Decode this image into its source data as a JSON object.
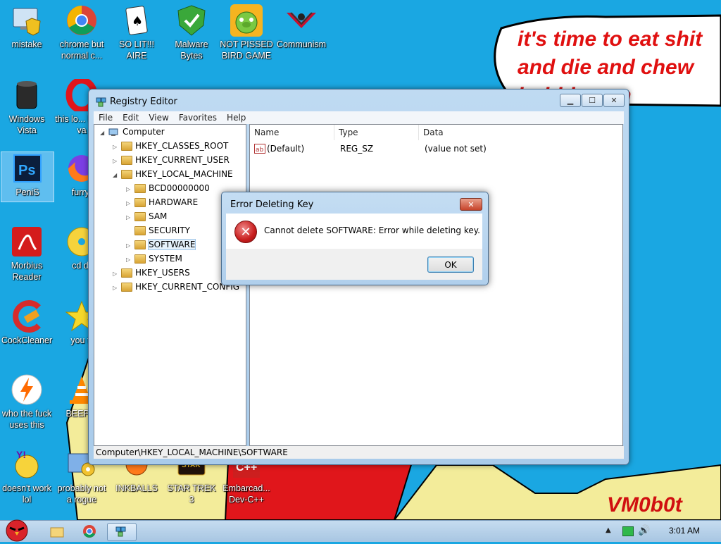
{
  "wallpaper": {
    "lines": [
      "it's time to eat shit",
      "and die and chew",
      "bubblegum"
    ],
    "signature": "VM0b0t"
  },
  "desktop_icons": [
    {
      "label": "mistake",
      "icon": "computer-shield-icon"
    },
    {
      "label": "chrome but normal c...",
      "icon": "chrome-icon"
    },
    {
      "label": "SO LIT!!! AIRE",
      "icon": "cards-icon"
    },
    {
      "label": "Malware Bytes",
      "icon": "shield-check-icon"
    },
    {
      "label": "NOT PISSED BIRD GAME",
      "icon": "green-pig-icon"
    },
    {
      "label": "Communism",
      "icon": "hammer-sickle-icon"
    },
    {
      "label": "Windows Vista",
      "icon": "trash-bin-icon"
    },
    {
      "label": "this lo... like a va",
      "icon": "opera-icon"
    },
    {
      "label": "PeniS",
      "icon": "photoshop-icon"
    },
    {
      "label": "furryf",
      "icon": "firefox-icon"
    },
    {
      "label": "Morbius Reader",
      "icon": "pdf-reader-icon"
    },
    {
      "label": "cd dr",
      "icon": "cd-icon"
    },
    {
      "label": "CockCleaner",
      "icon": "ccleaner-icon"
    },
    {
      "label": "you tr",
      "icon": "star-icon"
    },
    {
      "label": "who the fuck uses this",
      "icon": "lightning-icon"
    },
    {
      "label": "BEEP B",
      "icon": "vlc-cone-icon"
    },
    {
      "label": "doesn't work lol",
      "icon": "yahoo-icon"
    },
    {
      "label": "probably not a rogue",
      "icon": "gears-icon"
    },
    {
      "label": "INKBALLS",
      "icon": "inkball-icon"
    },
    {
      "label": "STAR TREK 3",
      "icon": "star-wars-icon"
    },
    {
      "label": "Embarcad... Dev-C++",
      "icon": "devcpp-icon"
    }
  ],
  "regedit": {
    "title": "Registry Editor",
    "menu": [
      "File",
      "Edit",
      "View",
      "Favorites",
      "Help"
    ],
    "tree": [
      {
        "label": "Computer",
        "depth": 0,
        "expander": "open"
      },
      {
        "label": "HKEY_CLASSES_ROOT",
        "depth": 1,
        "expander": "closed"
      },
      {
        "label": "HKEY_CURRENT_USER",
        "depth": 1,
        "expander": "closed"
      },
      {
        "label": "HKEY_LOCAL_MACHINE",
        "depth": 1,
        "expander": "open"
      },
      {
        "label": "BCD00000000",
        "depth": 2,
        "expander": "closed"
      },
      {
        "label": "HARDWARE",
        "depth": 2,
        "expander": "closed"
      },
      {
        "label": "SAM",
        "depth": 2,
        "expander": "closed"
      },
      {
        "label": "SECURITY",
        "depth": 2,
        "expander": "none"
      },
      {
        "label": "SOFTWARE",
        "depth": 2,
        "expander": "closed",
        "selected": true
      },
      {
        "label": "SYSTEM",
        "depth": 2,
        "expander": "closed"
      },
      {
        "label": "HKEY_USERS",
        "depth": 1,
        "expander": "closed"
      },
      {
        "label": "HKEY_CURRENT_CONFIG",
        "depth": 1,
        "expander": "closed"
      }
    ],
    "columns": [
      "Name",
      "Type",
      "Data"
    ],
    "values": [
      {
        "name": "(Default)",
        "type": "REG_SZ",
        "data": "(value not set)"
      }
    ],
    "status_path": "Computer\\HKEY_LOCAL_MACHINE\\SOFTWARE"
  },
  "error_dialog": {
    "title": "Error Deleting Key",
    "message": "Cannot delete SOFTWARE:  Error while deleting key.",
    "ok_label": "OK",
    "close_glyph": "✕",
    "icon_glyph": "✕"
  },
  "taskbar": {
    "time": "3:01 AM"
  },
  "colors": {
    "desktop_bg": "#1aa7e2",
    "wall_text": "#e01010",
    "error_red": "#c81e1e"
  }
}
